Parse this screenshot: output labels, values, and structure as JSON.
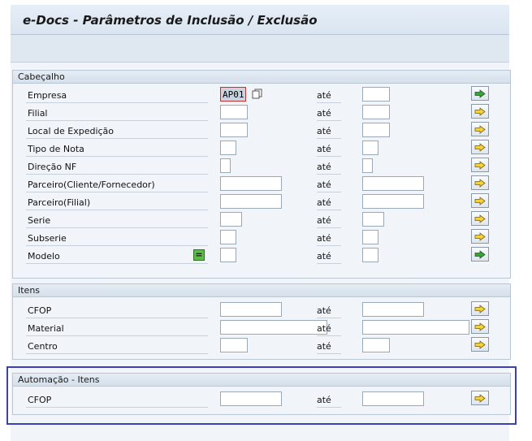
{
  "title": "e-Docs - Parâmetros de Inclusão / Exclusão",
  "range_word": "até",
  "groups": {
    "header": {
      "title": "Cabeçalho",
      "rows": [
        {
          "label": "Empresa",
          "low": "AP01",
          "high": ""
        },
        {
          "label": "Filial",
          "low": "",
          "high": ""
        },
        {
          "label": "Local de Expedição",
          "low": "",
          "high": ""
        },
        {
          "label": "Tipo de Nota",
          "low": "",
          "high": ""
        },
        {
          "label": "Direção NF",
          "low": "",
          "high": ""
        },
        {
          "label": "Parceiro(Cliente/Fornecedor)",
          "low": "",
          "high": ""
        },
        {
          "label": "Parceiro(Filial)",
          "low": "",
          "high": ""
        },
        {
          "label": "Serie",
          "low": "",
          "high": ""
        },
        {
          "label": "Subserie",
          "low": "",
          "high": ""
        },
        {
          "label": "Modelo",
          "low": "",
          "high": ""
        }
      ]
    },
    "items": {
      "title": "Itens",
      "rows": [
        {
          "label": "CFOP",
          "low": "",
          "high": ""
        },
        {
          "label": "Material",
          "low": "",
          "high": ""
        },
        {
          "label": "Centro",
          "low": "",
          "high": ""
        }
      ]
    },
    "automation": {
      "title": "Automação - Itens",
      "rows": [
        {
          "label": "CFOP",
          "low": "",
          "high": ""
        }
      ]
    }
  },
  "colors": {
    "highlight_border": "#3c40b8",
    "arrow_fill": "#f5d23a",
    "active_arrow_fill": "#39a33a"
  }
}
